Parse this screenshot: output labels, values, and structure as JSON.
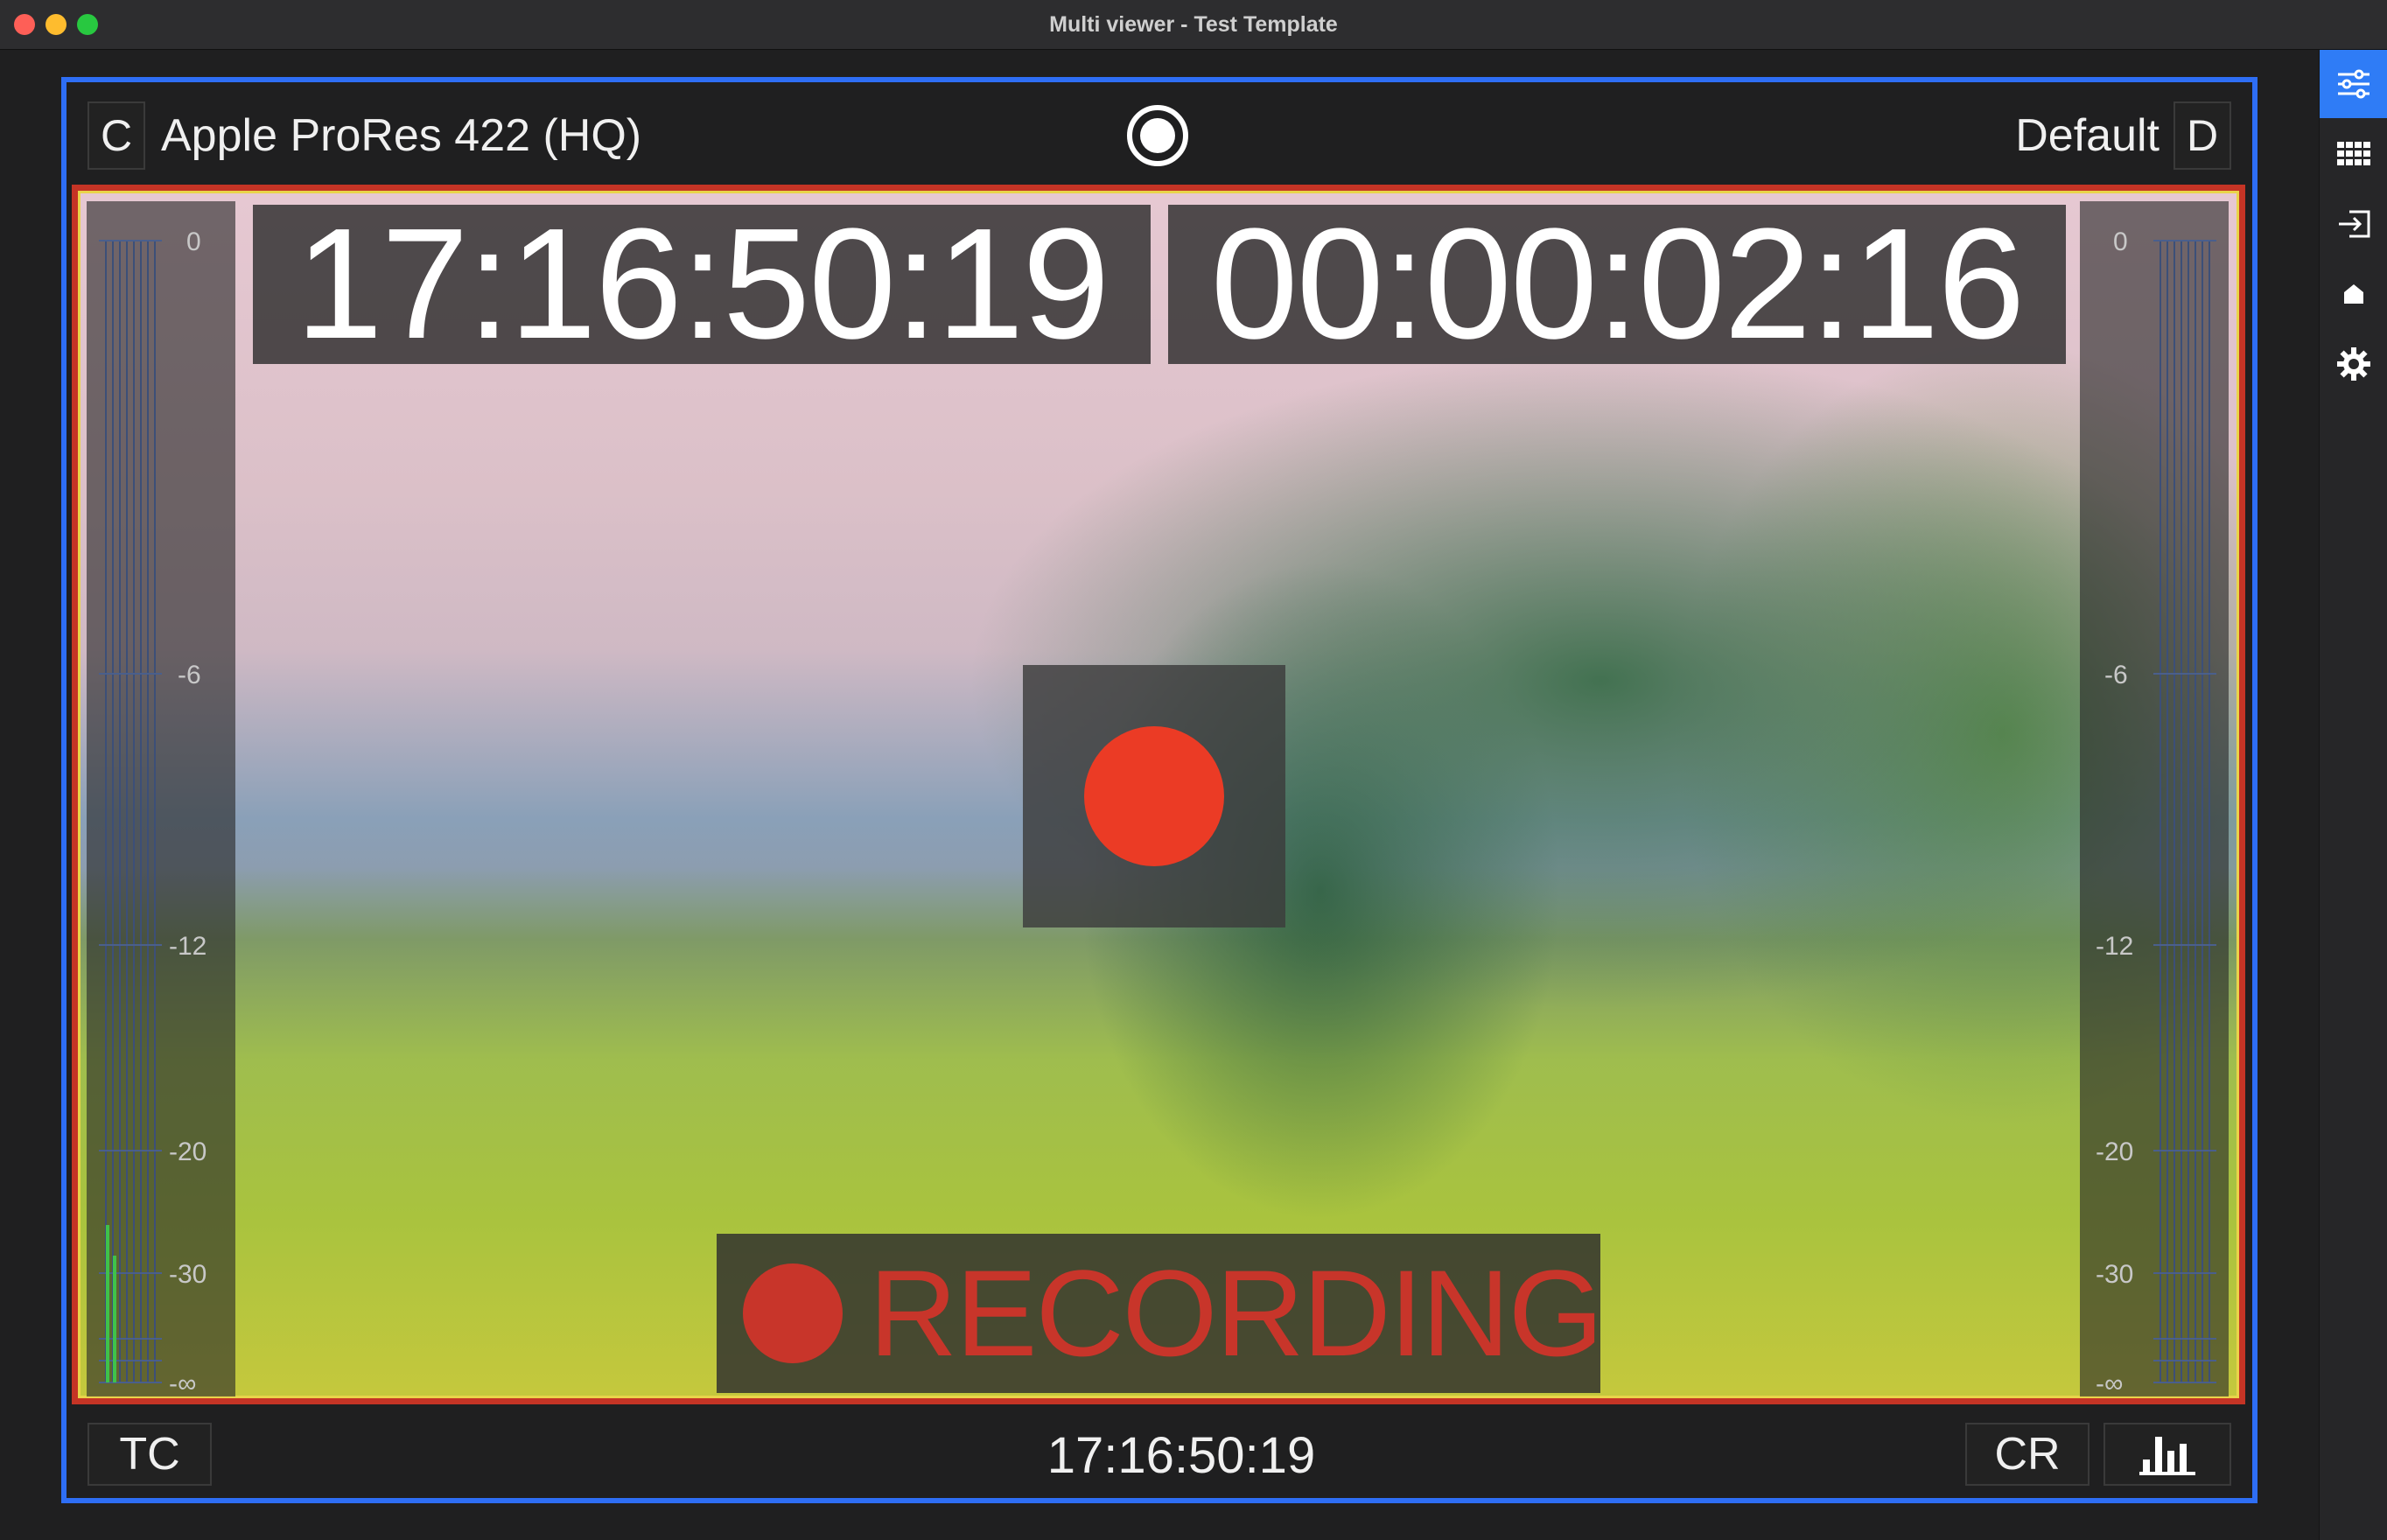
{
  "window": {
    "title": "Multi viewer - Test Template"
  },
  "top_bar": {
    "left_tag": "C",
    "codec": "Apple ProRes 422 (HQ)",
    "template": "Default",
    "right_tag": "D"
  },
  "overlays": {
    "timecode_primary": "17:16:50:19",
    "timecode_secondary": "00:00:02:16",
    "recording_label": "RECORDING"
  },
  "meters": {
    "scale": [
      "0",
      "-6",
      "-12",
      "-20",
      "-30",
      "-∞"
    ],
    "left_level_fraction": 0.08,
    "right_level_fraction": 0.0
  },
  "bottom_bar": {
    "tc_button": "TC",
    "timecode": "17:16:50:19",
    "cr_button": "CR"
  },
  "sidebar": {
    "items": [
      "sliders-icon",
      "grid-icon",
      "input-icon",
      "home-icon",
      "gear-icon"
    ],
    "active": "sliders-icon"
  },
  "colors": {
    "frame_blue": "#2e6ef5",
    "frame_red": "#c53425",
    "record_red": "#eb3b25",
    "meter_green": "#3fc24a"
  }
}
